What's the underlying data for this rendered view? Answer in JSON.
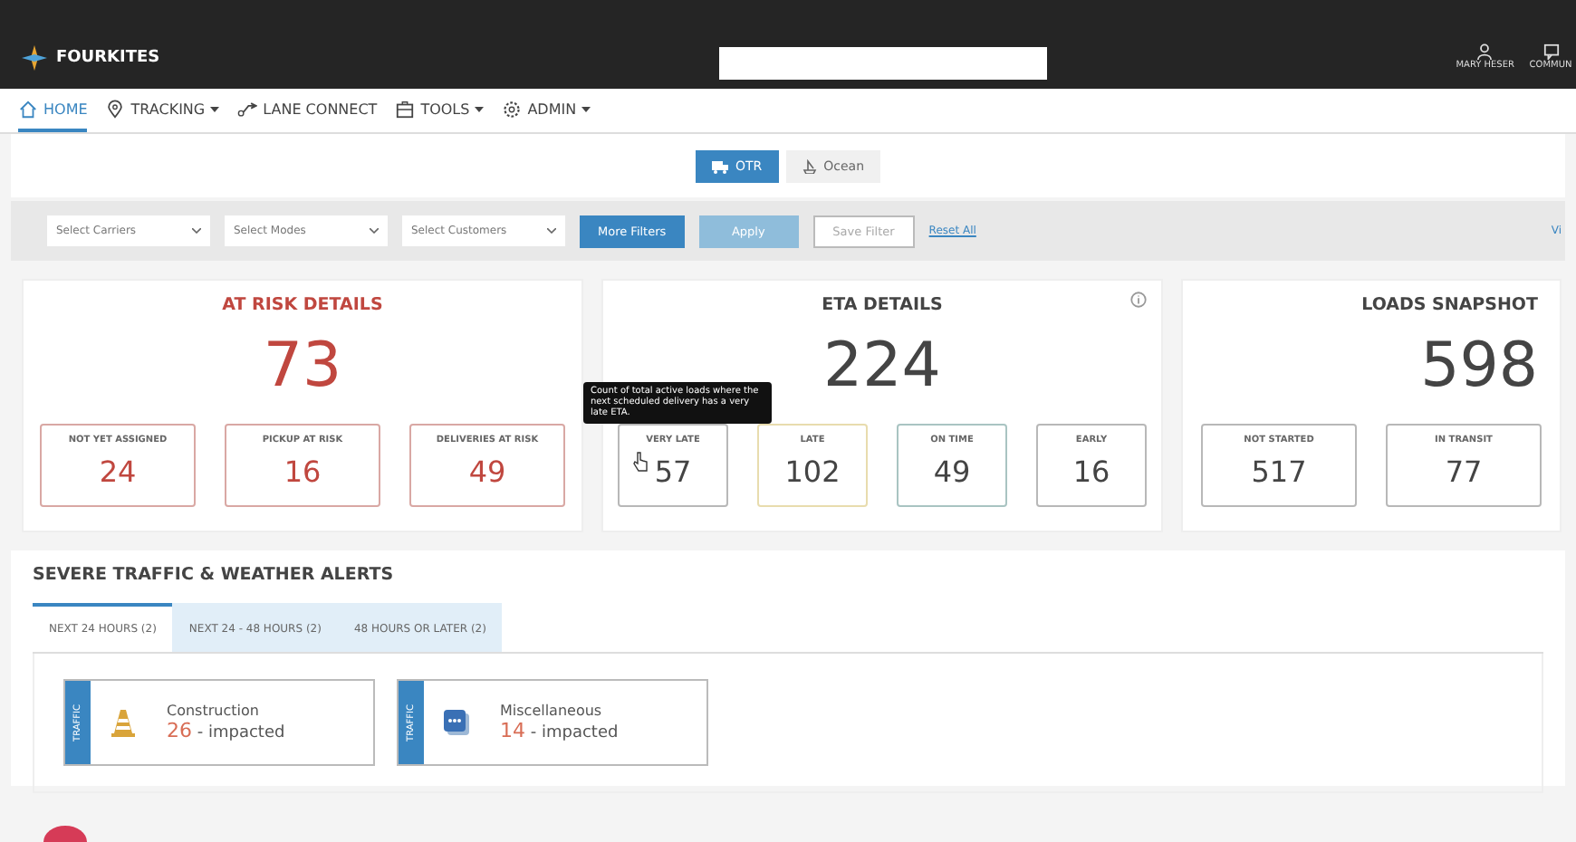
{
  "header": {
    "logo": "FOURKITES",
    "user": "MARY HESER",
    "community": "COMMUN"
  },
  "nav": [
    {
      "label": "HOME",
      "kind": "home",
      "selected": true,
      "caret": false
    },
    {
      "label": "TRACKING",
      "kind": "pin",
      "selected": false,
      "caret": true
    },
    {
      "label": "LANE CONNECT",
      "kind": "lane",
      "selected": false,
      "caret": false
    },
    {
      "label": "TOOLS",
      "kind": "tools",
      "selected": false,
      "caret": true
    },
    {
      "label": "ADMIN",
      "kind": "gear",
      "selected": false,
      "caret": true
    }
  ],
  "modes": [
    {
      "label": "OTR",
      "selected": true
    },
    {
      "label": "Ocean",
      "selected": false
    }
  ],
  "filters": {
    "selects": [
      {
        "placeholder": "Select Carriers"
      },
      {
        "placeholder": "Select Modes"
      },
      {
        "placeholder": "Select Customers"
      }
    ],
    "more": "More Filters",
    "apply": "Apply",
    "save": "Save Filter",
    "reset": "Reset All",
    "edge": "Vi"
  },
  "cards": [
    {
      "title": "AT RISK DETAILS",
      "total": "73",
      "color": "#c0473f",
      "info": false,
      "stats": [
        {
          "label": "NOT YET ASSIGNED",
          "value": "24",
          "color": "#d9a8a4"
        },
        {
          "label": "PICKUP AT RISK",
          "value": "16",
          "color": "#d9a8a4"
        },
        {
          "label": "DELIVERIES AT RISK",
          "value": "49",
          "color": "#d9a8a4"
        }
      ]
    },
    {
      "title": "ETA DETAILS",
      "total": "224",
      "color": "#444444",
      "info": true,
      "stats": [
        {
          "label": "VERY LATE",
          "value": "57",
          "color": "#b8b8b8"
        },
        {
          "label": "LATE",
          "value": "102",
          "color": "#e8dcae"
        },
        {
          "label": "ON TIME",
          "value": "49",
          "color": "#a9c4c2"
        },
        {
          "label": "EARLY",
          "value": "16",
          "color": "#b8b8b8"
        }
      ]
    },
    {
      "title": "LOADS SNAPSHOT",
      "total": "598",
      "color": "#444444",
      "info": false,
      "stats": [
        {
          "label": "NOT STARTED",
          "value": "517",
          "color": "#b8b8b8"
        },
        {
          "label": "IN TRANSIT",
          "value": "77",
          "color": "#b8b8b8"
        }
      ]
    }
  ],
  "tooltip": "Count of total active loads where the next scheduled delivery has a very late ETA.",
  "alerts": {
    "title": "SEVERE TRAFFIC & WEATHER ALERTS",
    "tabs": [
      {
        "label": "NEXT 24 HOURS (2)",
        "selected": true
      },
      {
        "label": "NEXT 24 - 48 HOURS (2)",
        "selected": false
      },
      {
        "label": "48 HOURS OR LATER (2)",
        "selected": false
      }
    ],
    "items": [
      {
        "tag": "TRAFFIC",
        "kind": "cone",
        "name": "Construction",
        "count": "26",
        "suffix": "- impacted"
      },
      {
        "tag": "TRAFFIC",
        "kind": "message",
        "name": "Miscellaneous",
        "count": "14",
        "suffix": "- impacted"
      }
    ]
  }
}
